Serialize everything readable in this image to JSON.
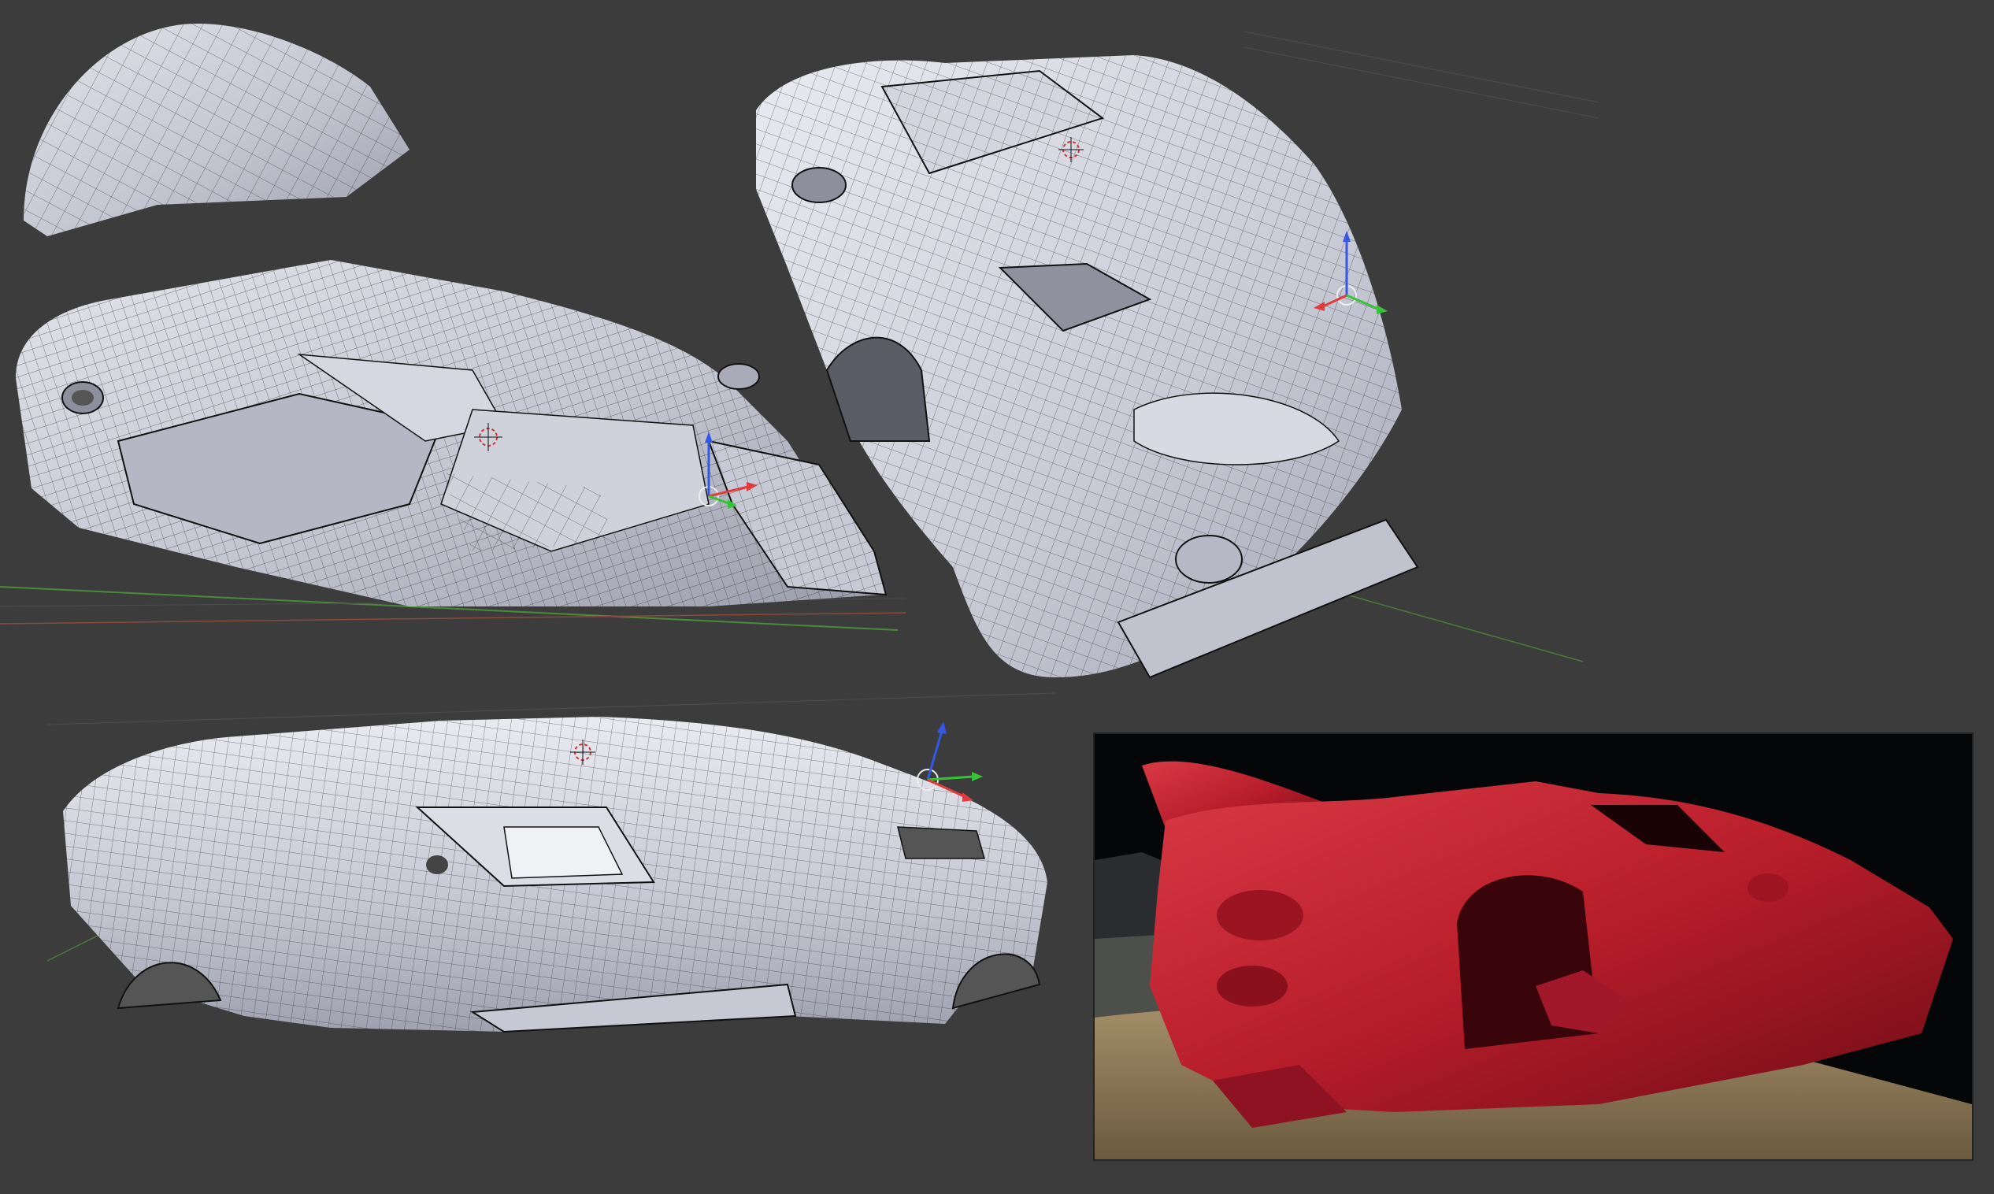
{
  "scene": {
    "background_color": "#3c3c3c",
    "mesh_color": "#c9cbd6",
    "wire_color": "#1a1a1a",
    "render_color": "#b81d2a"
  },
  "viewports": [
    {
      "id": "top-left",
      "view": "underside-rear",
      "object": "car-body-mesh"
    },
    {
      "id": "top-right",
      "view": "front-three-quarter",
      "object": "car-body-mesh"
    },
    {
      "id": "bottom-left",
      "view": "side",
      "object": "car-body-mesh"
    }
  ],
  "render_preview": {
    "object": "car-body-render",
    "background": "dark-sky-and-ground"
  },
  "gizmo": {
    "x_axis_color": "#e23b3b",
    "y_axis_color": "#38c23a",
    "z_axis_color": "#3557e8"
  }
}
